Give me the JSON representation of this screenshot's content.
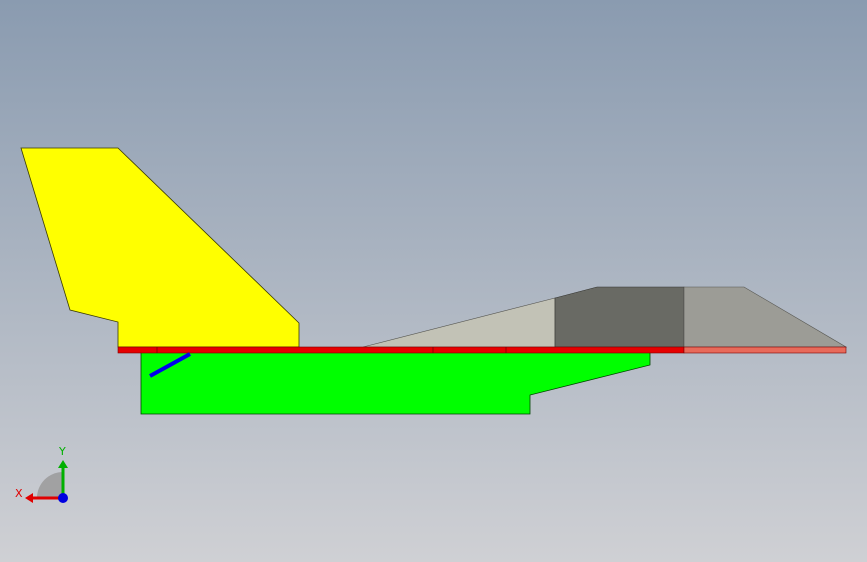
{
  "view": {
    "background_top": "#8a9bb0",
    "background_bottom": "#cfd0d4"
  },
  "model": {
    "parts": [
      {
        "name": "tail-fin",
        "color": "#ffff00"
      },
      {
        "name": "fuselage-body",
        "color": "#00ff00"
      },
      {
        "name": "wing-plate",
        "color": "#e60000"
      },
      {
        "name": "canopy-front-panel",
        "color": "#c2c2b6"
      },
      {
        "name": "canopy-middle-panel",
        "color": "#696a64"
      },
      {
        "name": "canopy-rear-panel",
        "color": "#9c9c96"
      },
      {
        "name": "strut",
        "color": "#0000ee"
      }
    ]
  },
  "triad": {
    "x_label": "X",
    "y_label": "Y",
    "x_color": "#e00000",
    "y_color": "#00b000",
    "z_color": "#0000e0"
  }
}
